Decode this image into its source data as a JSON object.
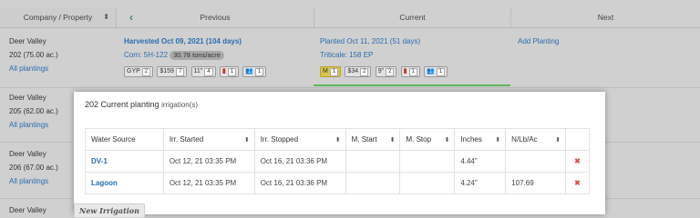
{
  "header": {
    "company_property": "Company / Property",
    "previous": "Previous",
    "current": "Current",
    "next": "Next"
  },
  "rows": [
    {
      "farm": "Deer Valley",
      "field": "202 (75.00 ac.)",
      "link": "All plantings"
    },
    {
      "farm": "Deer Valley",
      "field": "205 (62.00 ac.)",
      "link": "All plantings"
    },
    {
      "farm": "Deer Valley",
      "field": "206 (67.00 ac.)",
      "link": "All plantings"
    },
    {
      "farm": "Deer Valley"
    }
  ],
  "previous": {
    "harvested": "Harvested Oct 09, 2021 (104 days)",
    "crop": "Corn: 5H-122",
    "yield": "30.78 tons/acre",
    "chips": [
      {
        "label": "GYP",
        "count": "2"
      },
      {
        "label": "$159",
        "count": "7"
      },
      {
        "label": "11\"",
        "count": "4"
      },
      {
        "label": "pdf-icon",
        "count": "1"
      },
      {
        "label": "team-icon",
        "count": "1"
      }
    ]
  },
  "current": {
    "planted": "Planted Oct 11, 2021 (51 days)",
    "crop": "Triticale: 158 EP",
    "chips": [
      {
        "label": "M",
        "count": "1"
      },
      {
        "label": "$34",
        "count": "2"
      },
      {
        "label": "9\"",
        "count": "2"
      },
      {
        "label": "pdf-icon",
        "count": "1"
      },
      {
        "label": "team-icon",
        "count": "1"
      }
    ]
  },
  "next": {
    "add_planting": "Add Planting"
  },
  "modal": {
    "title": "202 Current planting",
    "subtitle": "irrigation(s)",
    "columns": [
      "Water Source",
      "Irr. Started",
      "Irr. Stopped",
      "M. Start",
      "M. Stop",
      "Inches",
      "N/Lb/Ac",
      ""
    ],
    "rows": [
      {
        "source": "DV-1",
        "started": "Oct 12, 21 03:35 PM",
        "stopped": "Oct 16, 21 03:36 PM",
        "m_start": "",
        "m_stop": "",
        "inches": "4.44\"",
        "n_lb_ac": "",
        "delete": "✖"
      },
      {
        "source": "Lagoon",
        "started": "Oct 12, 21 03:35 PM",
        "stopped": "Oct 16, 21 03:36 PM",
        "m_start": "",
        "m_stop": "",
        "inches": "4.24\"",
        "n_lb_ac": "107.69",
        "delete": "✖"
      }
    ]
  },
  "new_irrigation": "New Irrigation",
  "colors": {
    "link": "#2b6cb0",
    "accent_green": "#5cb85c",
    "delete": "#d9534f"
  }
}
